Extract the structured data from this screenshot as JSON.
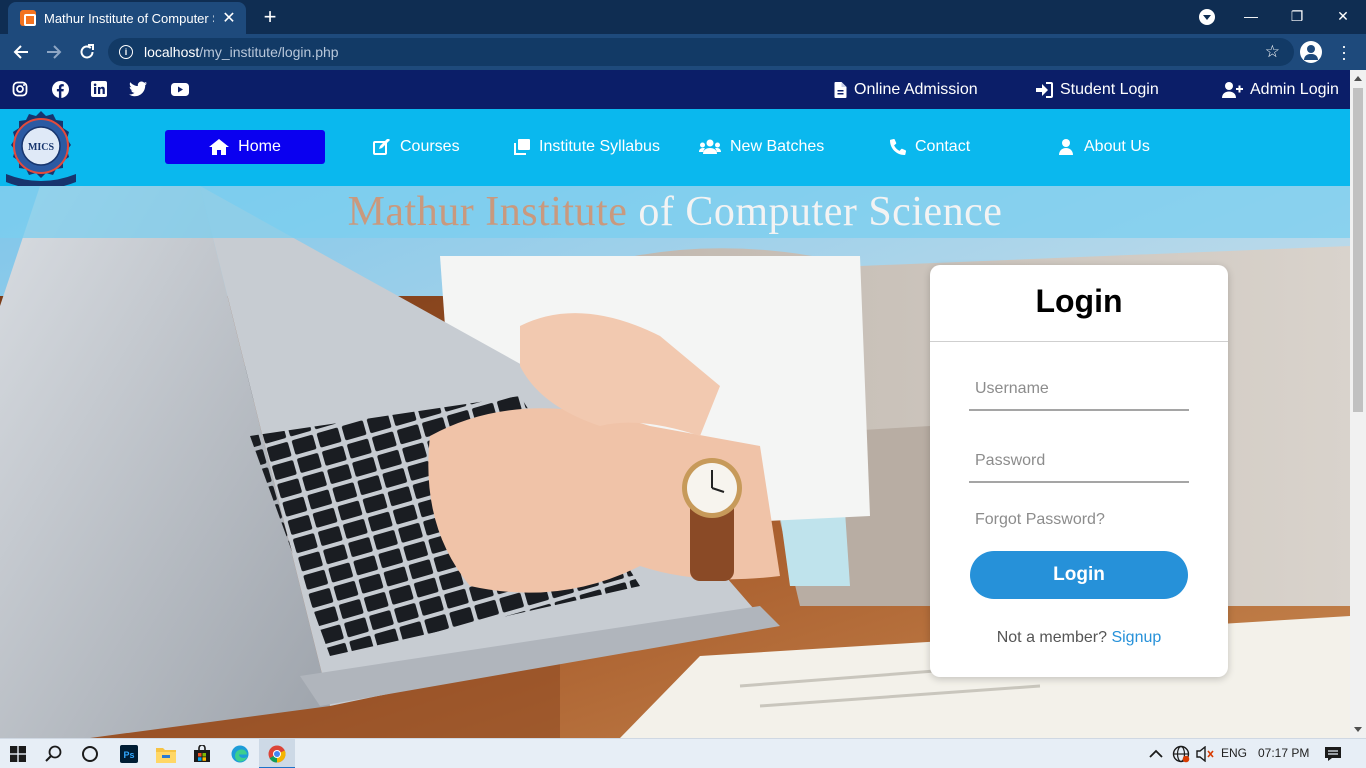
{
  "browser": {
    "tab_title": "Mathur Institute of Computer Sci",
    "tab_close": "✕",
    "new_tab": "+",
    "url_host": "localhost",
    "url_path": "/my_institute/login.php",
    "window_controls": [
      "—",
      "❐",
      "✕"
    ]
  },
  "topbar": {
    "social_icons": [
      "instagram-icon",
      "facebook-icon",
      "linkedin-icon",
      "twitter-icon",
      "youtube-icon"
    ],
    "online_admission": "Online Admission",
    "student_login": "Student Login",
    "admin_login": "Admin Login"
  },
  "navbar": {
    "logo_text": "MICS",
    "items": [
      {
        "label": "Home",
        "icon": "home-icon"
      },
      {
        "label": "Courses",
        "icon": "edit-icon"
      },
      {
        "label": "Institute Syllabus",
        "icon": "copy-icon"
      },
      {
        "label": "New Batches",
        "icon": "users-icon"
      },
      {
        "label": "Contact",
        "icon": "phone-icon"
      },
      {
        "label": "About Us",
        "icon": "user-icon"
      }
    ]
  },
  "hero": {
    "title_part1": "Mathur Institute",
    "title_part2": " of Computer Science"
  },
  "login": {
    "heading": "Login",
    "username_placeholder": "Username",
    "password_placeholder": "Password",
    "forgot": "Forgot Password?",
    "button": "Login",
    "not_member": "Not a member? ",
    "signup": "Signup"
  },
  "taskbar": {
    "language": "ENG",
    "time": "07:17 PM"
  }
}
